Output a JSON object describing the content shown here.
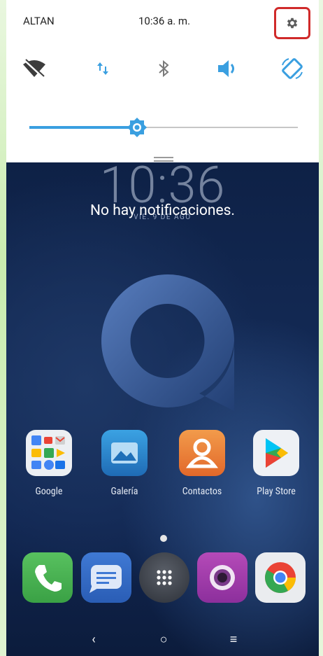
{
  "status_bar": {
    "carrier": "ALTAN",
    "time": "10:36 a. m.",
    "settings_icon": "gear-icon"
  },
  "quick_toggles": [
    {
      "id": "wifi",
      "icon": "wifi-off-icon",
      "state": "off"
    },
    {
      "id": "data",
      "icon": "mobile-data-icon",
      "state": "on"
    },
    {
      "id": "bluetooth",
      "icon": "bluetooth-icon",
      "state": "off"
    },
    {
      "id": "sound",
      "icon": "volume-icon",
      "state": "on"
    },
    {
      "id": "rotate",
      "icon": "auto-rotate-icon",
      "state": "on"
    }
  ],
  "brightness": {
    "level": 0.4,
    "icon": "brightness-icon"
  },
  "lockscreen": {
    "clock": "10:36",
    "date": "VIE. 9 DE AGO",
    "notification_message": "No hay notificaciones."
  },
  "apps": [
    {
      "label": "Google",
      "icon": "google-folder-icon"
    },
    {
      "label": "Galería",
      "icon": "gallery-icon"
    },
    {
      "label": "Contactos",
      "icon": "contacts-icon"
    },
    {
      "label": "Play Store",
      "icon": "play-store-icon"
    }
  ],
  "dock": [
    {
      "icon": "phone-icon"
    },
    {
      "icon": "messages-icon"
    },
    {
      "icon": "app-drawer-icon"
    },
    {
      "icon": "camera-icon"
    },
    {
      "icon": "chrome-icon"
    }
  ],
  "navigation": {
    "back": "‹",
    "home": "○",
    "recents": "≡"
  },
  "colors": {
    "accent": "#3a9fe0",
    "settings_highlight": "#d02a2a",
    "wallpaper": "#142b57"
  }
}
